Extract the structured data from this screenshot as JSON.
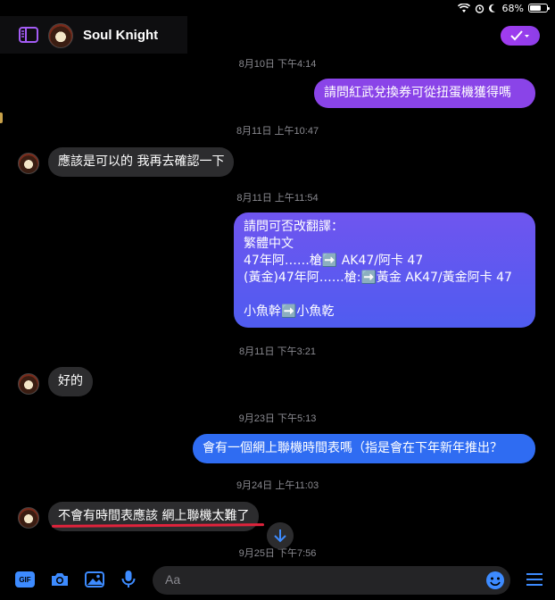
{
  "status_bar": {
    "battery": "68%"
  },
  "header": {
    "title": "Soul Knight"
  },
  "timestamps": [
    "8月10日 下午4:14",
    "8月11日 上午10:47",
    "8月11日 上午11:54",
    "8月11日 下午3:21",
    "9月23日 下午5:13",
    "9月24日 上午11:03",
    "9月25日 下午7:56"
  ],
  "messages": {
    "m1": "請問紅武兌換券可從扭蛋機獲得嗎",
    "m2": "應該是可以的 我再去確認一下",
    "m3_lines": [
      "請問可否改翻譯：",
      "繁體中文",
      "47年阿……槍➡️ AK47/阿卡 47",
      "(黃金)47年阿……槍:➡️黃金 AK47/黃金阿卡 47",
      "",
      "小魚幹➡️小魚乾"
    ],
    "m4": "好的",
    "m5": "會有一個網上聯機時間表嗎（指是會在下年新年推出？",
    "m6": "不會有時間表應該 網上聯機太難了"
  },
  "composer": {
    "placeholder": "Aa",
    "gif_label": "GIF"
  },
  "colors": {
    "accent": "#a23cf0",
    "outgoing_bubble_top": "#8b44e8",
    "outgoing_bubble_bottom": "#2f6cf2",
    "incoming_bubble": "#2c2c2e",
    "highlight": "#e0233c",
    "icon_blue": "#3d8bff"
  }
}
